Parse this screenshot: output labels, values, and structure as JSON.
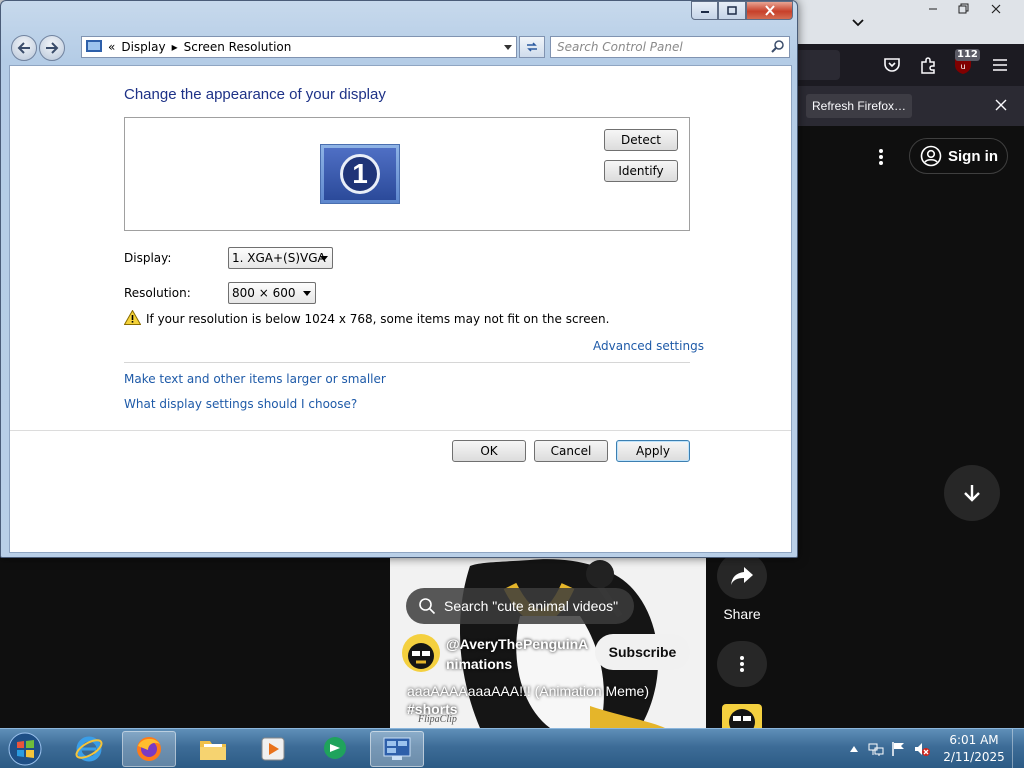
{
  "window": {
    "breadcrumb": [
      "Display",
      "Screen Resolution"
    ],
    "search_placeholder": "Search Control Panel",
    "title": "Change the appearance of your display",
    "monitor_number": "1",
    "detect_label": "Detect",
    "identify_label": "Identify",
    "display_label": "Display:",
    "display_value": "1. XGA+(S)VGA",
    "resolution_label": "Resolution:",
    "resolution_value": "800 × 600",
    "warning_text": "If your resolution is below 1024 x 768, some items may not fit on the screen.",
    "advanced_link": "Advanced settings",
    "links": [
      "Make text and other items larger or smaller",
      "What display settings should I choose?"
    ],
    "ok_label": "OK",
    "cancel_label": "Cancel",
    "apply_label": "Apply"
  },
  "browser": {
    "ublock_badge": "112",
    "notification_button": "Refresh Firefox…",
    "sign_in_label": "Sign in"
  },
  "short": {
    "search_text": "Search \"cute animal videos\"",
    "channel_name": "@AveryThePenguinAnimations",
    "subscribe_label": "Subscribe",
    "video_title": "aaaAAAAaaaAAA!!!  (Animation Meme)",
    "hashtag": "#shorts",
    "watermark": "FlipaClip",
    "share_label": "Share"
  },
  "taskbar": {
    "time": "6:01 AM",
    "date": "2/11/2025"
  },
  "colors": {
    "link_blue": "#1e5aa8",
    "heading_blue": "#1e3287",
    "taskbar": "#3d6c97",
    "youtube_bg": "#0f0f0f"
  },
  "icons": {
    "taskbar": [
      "windows-start-icon",
      "internet-explorer-icon",
      "firefox-icon",
      "file-explorer-icon",
      "media-player-icon",
      "chat-icon",
      "control-panel-icon"
    ],
    "tray": [
      "show-hidden-icons-icon",
      "network-icon",
      "action-center-flag-icon",
      "volume-muted-icon"
    ]
  }
}
